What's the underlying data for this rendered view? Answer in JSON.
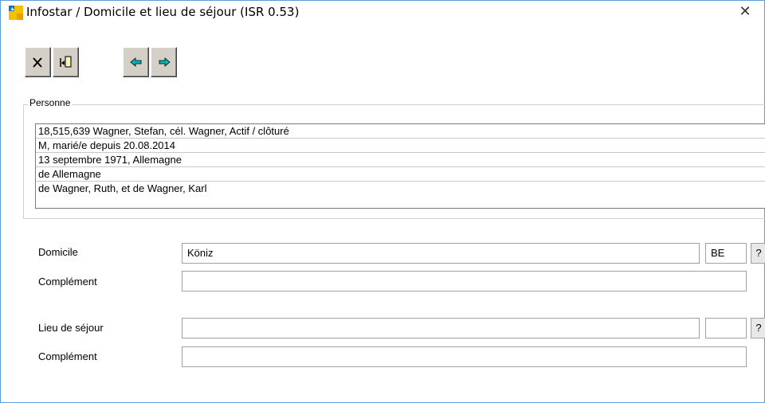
{
  "window": {
    "title": "Infostar / Domicile et lieu de séjour (ISR 0.53)",
    "close_glyph": "✕"
  },
  "toolbar": {
    "buttons": [
      {
        "icon": "x-close-icon"
      },
      {
        "icon": "exit-door-icon"
      },
      {
        "icon": "arrow-left-icon"
      },
      {
        "icon": "arrow-right-icon"
      }
    ],
    "arrow_color": "#00a0a0"
  },
  "personne": {
    "label": "Personne",
    "lines": [
      "18,515,639  Wagner, Stefan, cél. Wagner, Actif / clôturé",
      "M, marié/e depuis 20.08.2014",
      "13 septembre 1971, Allemagne",
      "de Allemagne",
      "de Wagner, Ruth, et de Wagner, Karl"
    ]
  },
  "domicile": {
    "label": "Domicile",
    "value": "Köniz",
    "canton": "BE",
    "help": "?",
    "complement_label": "Complément",
    "complement_value": ""
  },
  "sejour": {
    "label": "Lieu de séjour",
    "value": "",
    "canton": "",
    "help": "?",
    "complement_label": "Complément",
    "complement_value": ""
  }
}
